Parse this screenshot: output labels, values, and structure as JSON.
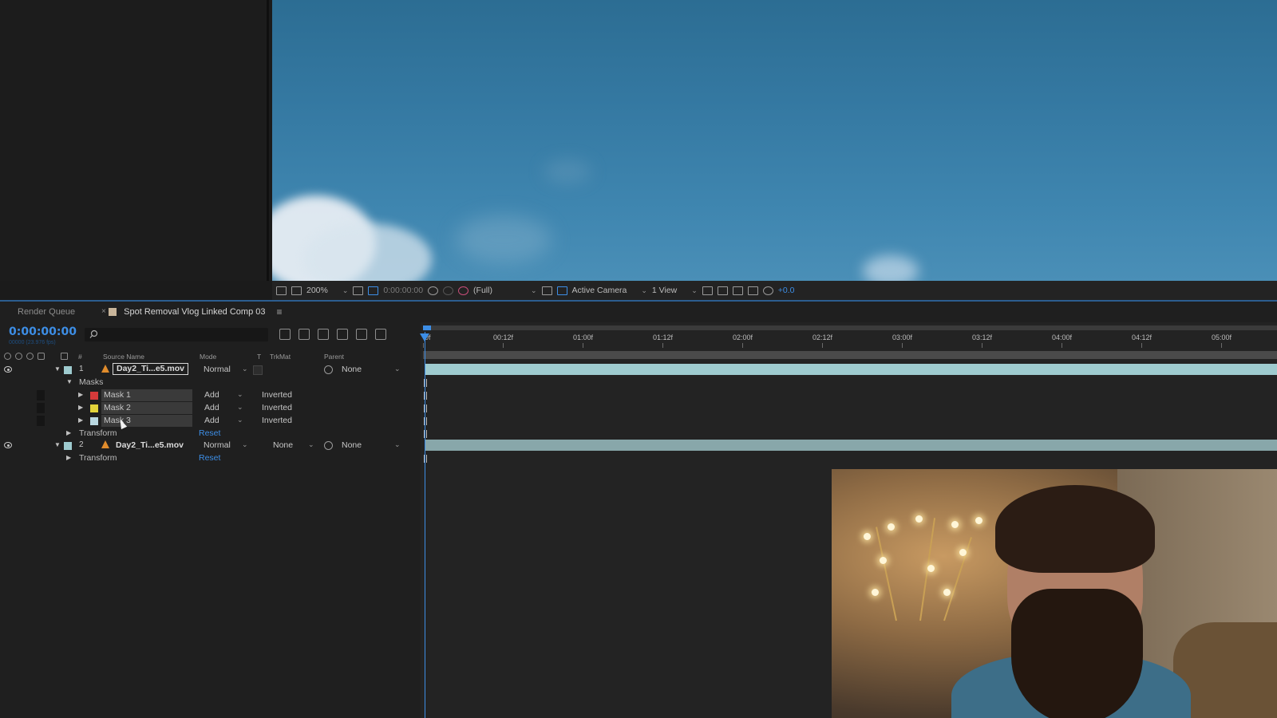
{
  "viewer": {
    "zoom": "200%",
    "timecode": "0:00:00:00",
    "resolution": "(Full)",
    "camera": "Active Camera",
    "view_layout": "1 View",
    "exposure": "+0.0"
  },
  "tabs": {
    "render_queue": "Render Queue",
    "close": "×",
    "comp": "Spot Removal Vlog Linked Comp 03",
    "menu": "≡"
  },
  "timeline": {
    "timecode": "0:00:00:00",
    "fps": "00000 (23.976 fps)",
    "columns": {
      "hash": "#",
      "source_name": "Source Name",
      "mode": "Mode",
      "t": "T",
      "trkmat": "TrkMat",
      "parent": "Parent"
    },
    "ruler": [
      "0f",
      "00:12f",
      "01:00f",
      "01:12f",
      "02:00f",
      "02:12f",
      "03:00f",
      "03:12f",
      "04:00f",
      "04:12f",
      "05:00f"
    ]
  },
  "layers": [
    {
      "index": "1",
      "name": "Day2_Ti...e5.mov",
      "mode": "Normal",
      "parent": "None",
      "masks_label": "Masks",
      "masks": [
        {
          "name": "Mask 1",
          "mode": "Add",
          "inverted": "Inverted",
          "color": "#d63a3a"
        },
        {
          "name": "Mask 2",
          "mode": "Add",
          "inverted": "Inverted",
          "color": "#e2d33a"
        },
        {
          "name": "Mask 3",
          "mode": "Add",
          "inverted": "Inverted",
          "color": "#b9d7e0"
        }
      ],
      "transform": "Transform",
      "reset": "Reset"
    },
    {
      "index": "2",
      "name": "Day2_Ti...e5.mov",
      "mode": "Normal",
      "trkmat": "None",
      "parent": "None",
      "transform": "Transform",
      "reset": "Reset"
    }
  ],
  "colors": {
    "accent": "#3d8ee6",
    "layer_label": "#9ecbcf",
    "warning": "#e08c2c"
  }
}
